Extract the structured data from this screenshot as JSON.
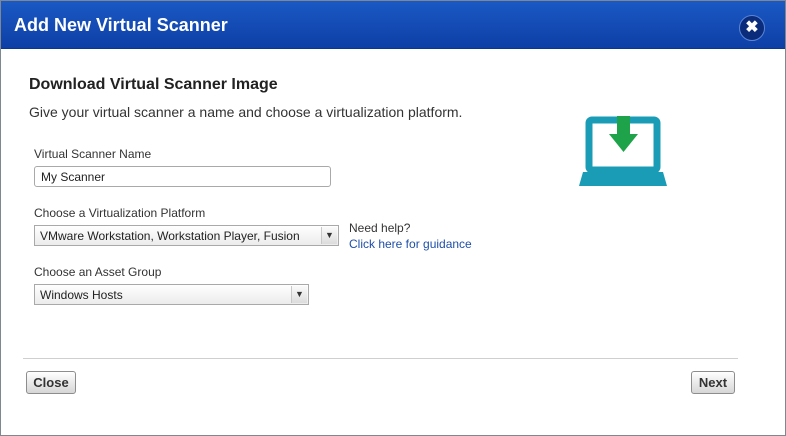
{
  "dialog": {
    "title": "Add New Virtual Scanner",
    "close_glyph": "✖",
    "heading": "Download Virtual Scanner Image",
    "subtitle": "Give your virtual scanner a name and choose a virtualization platform."
  },
  "form": {
    "name_label": "Virtual Scanner Name",
    "name_value": "My Scanner",
    "platform_label": "Choose a Virtualization Platform",
    "platform_value": "VMware Workstation, Workstation Player, Fusion",
    "asset_group_label": "Choose an Asset Group",
    "asset_group_value": "Windows Hosts"
  },
  "help": {
    "question": "Need help?",
    "link_text": "Click here for guidance"
  },
  "footer": {
    "close_label": "Close",
    "next_label": "Next"
  },
  "icons": {
    "dropdown_arrow": "▼",
    "illustration": "laptop-download-icon"
  },
  "colors": {
    "titlebar": "#1b59c4",
    "laptop": "#1a9cb6",
    "download_arrow": "#1fa34a",
    "link": "#1f4fa8"
  }
}
